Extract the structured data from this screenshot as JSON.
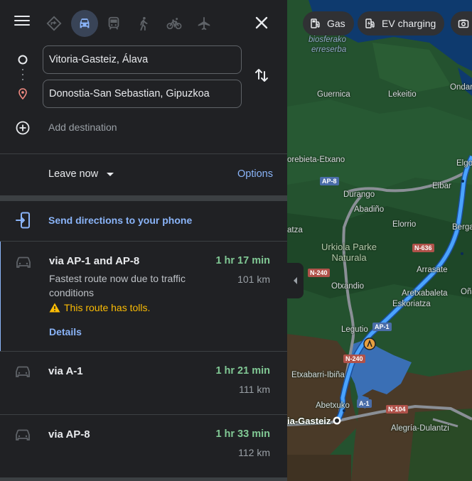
{
  "travel_modes": [
    {
      "name": "best-travel-mode",
      "icon": "diamond-directions-icon",
      "active": false
    },
    {
      "name": "driving",
      "icon": "car-icon",
      "active": true
    },
    {
      "name": "transit",
      "icon": "train-icon",
      "active": false
    },
    {
      "name": "walking",
      "icon": "walking-icon",
      "active": false
    },
    {
      "name": "cycling",
      "icon": "bicycle-icon",
      "active": false
    },
    {
      "name": "flights",
      "icon": "airplane-icon",
      "active": false
    }
  ],
  "origin": {
    "value": "Vitoria-Gasteiz, Álava"
  },
  "destination": {
    "value": "Donostia-San Sebastian, Gipuzkoa"
  },
  "add_destination": "Add destination",
  "leave_now": "Leave now",
  "options": "Options",
  "send_to_phone": "Send directions to your phone",
  "routes": [
    {
      "name": "via AP-1 and AP-8",
      "time": "1 hr 17 min",
      "distance": "101 km",
      "description": "Fastest route now due to traffic conditions",
      "toll_warning": "This route has tolls.",
      "details": "Details"
    },
    {
      "name": "via A-1",
      "time": "1 hr 21 min",
      "distance": "111 km"
    },
    {
      "name": "via AP-8",
      "time": "1 hr 33 min",
      "distance": "112 km"
    }
  ],
  "map": {
    "chips": [
      {
        "label": "Gas",
        "icon": "gas-station-icon"
      },
      {
        "label": "EV charging",
        "icon": "ev-charging-icon"
      }
    ],
    "places": {
      "biosphere_line1": "biosferako",
      "biosphere_line2": "erreserba",
      "lekeitio": "Lekeitio",
      "ondarroa": "Ondar",
      "guernica": "Guernica",
      "amorebieta": "orebieta-Etxano",
      "elgoibar": "Elgo",
      "durango": "Durango",
      "eibar": "Eibar",
      "abadino": "Abadiño",
      "zeanuri": "atza",
      "elorrio": "Elorrio",
      "bergara": "Berga",
      "urkiola_line1": "Urkiola Parke",
      "urkiola_line2": "Naturala",
      "arrasate": "Arrasate",
      "otxandio": "Otxandio",
      "onati": "Oña",
      "aretxabaleta": "Aretxabaleta",
      "eskoriatza": "Eskoriatza",
      "legutio": "Legutio",
      "etxabarri": "Etxabarri-Ibiña",
      "abetxuko": "Abetxuko",
      "vitoria": "ia-Gasteiz",
      "alegria": "Alegría-Dulantzi"
    },
    "shields": {
      "ap8": "AP-8",
      "n636": "N-636",
      "n240_a": "N-240",
      "ap1": "AP-1",
      "n240_b": "N-240",
      "a1": "A-1",
      "n104": "N-104"
    },
    "colors": {
      "land": "#1e4a2a",
      "sea": "#0e3a6e",
      "reservoir": "#3a6fb5",
      "route_selected": "#4aa3ff",
      "route_alt": "#8a8f96",
      "farmland": "#4a3a28"
    }
  }
}
